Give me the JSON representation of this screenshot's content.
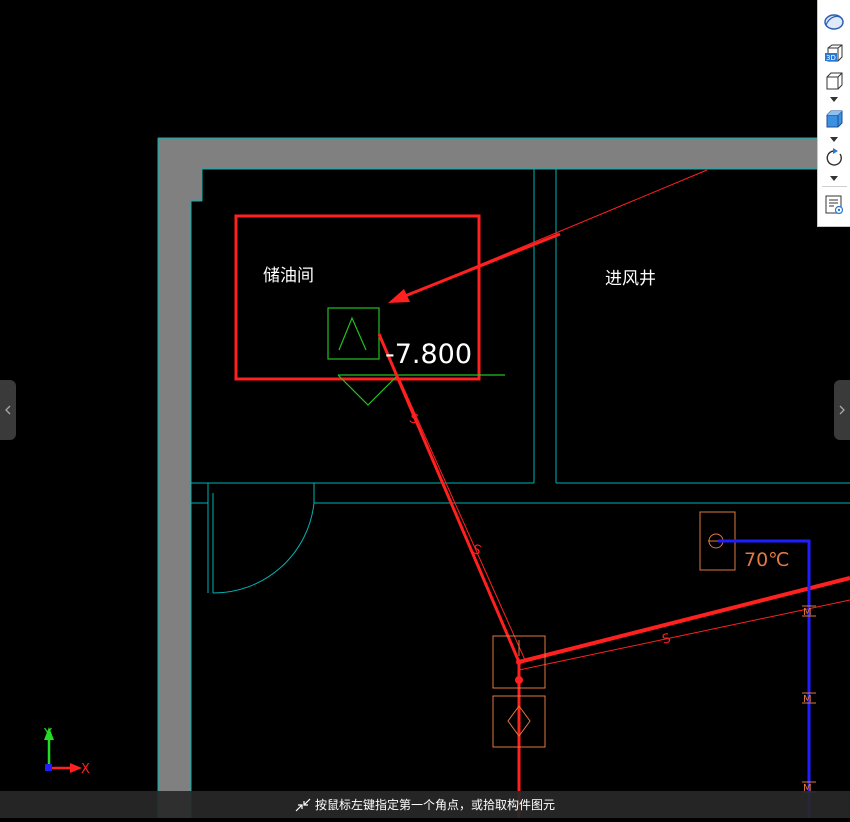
{
  "drawing": {
    "room_labels": [
      "储油间",
      "进风井"
    ],
    "elevation_label": "-7.800",
    "temperature_label": "70℃",
    "pipe_marks": [
      "S",
      "S",
      "S"
    ],
    "pipe_marks_blue": [
      "M",
      "M",
      "M"
    ]
  },
  "axis": {
    "x_label": "X",
    "y_label": "Y"
  },
  "toolbar": {
    "buttons": [
      {
        "icon": "orbit-icon"
      },
      {
        "icon": "view-3d-icon",
        "text": "3D"
      },
      {
        "icon": "view-cube-icon"
      },
      {
        "icon": "shaded-cube-icon"
      },
      {
        "icon": "rotate-icon"
      },
      {
        "icon": "properties-list-icon"
      }
    ]
  },
  "status": {
    "message": "按鼠标左键指定第一个角点，或拾取构件图元"
  },
  "colors": {
    "background": "#000000",
    "wall": "#808080",
    "wall_outline": "#00b3b3",
    "pipe_red": "#ff2020",
    "pipe_blue": "#1e1eff",
    "equipment": "#e07840",
    "symbol_green": "#22c022",
    "axis_x": "#ff2020",
    "axis_y": "#22dd22"
  }
}
